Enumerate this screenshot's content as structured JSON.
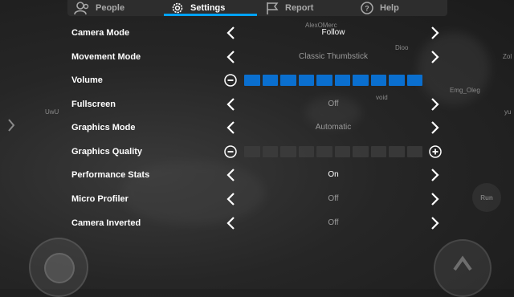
{
  "tabs": [
    {
      "label": "People",
      "icon": "people-icon",
      "active": false
    },
    {
      "label": "Settings",
      "icon": "gear-icon",
      "active": true
    },
    {
      "label": "Report",
      "icon": "flag-icon",
      "active": false
    },
    {
      "label": "Help",
      "icon": "help-icon",
      "active": false
    }
  ],
  "settings": [
    {
      "label": "Camera Mode",
      "control": "selector",
      "value": "Follow"
    },
    {
      "label": "Movement Mode",
      "control": "selector",
      "value": "Classic Thumbstick"
    },
    {
      "label": "Volume",
      "control": "slider",
      "level": 10,
      "max": 10
    },
    {
      "label": "Fullscreen",
      "control": "selector",
      "value": "Off"
    },
    {
      "label": "Graphics Mode",
      "control": "selector",
      "value": "Automatic"
    },
    {
      "label": "Graphics Quality",
      "control": "slider",
      "level": 0,
      "max": 10
    },
    {
      "label": "Performance Stats",
      "control": "selector",
      "value": "On"
    },
    {
      "label": "Micro Profiler",
      "control": "selector",
      "value": "Off"
    },
    {
      "label": "Camera Inverted",
      "control": "selector",
      "value": "Off"
    }
  ],
  "world_labels": [
    "AlexOMerc",
    "Dioo",
    "Zol",
    "Emg_Oleg",
    "void",
    "UwU",
    "yu"
  ],
  "run_label": "Run",
  "colors": {
    "accent": "#00a2ff",
    "slider_on": "#0a6fcf",
    "panel": "#2d2d2d"
  }
}
